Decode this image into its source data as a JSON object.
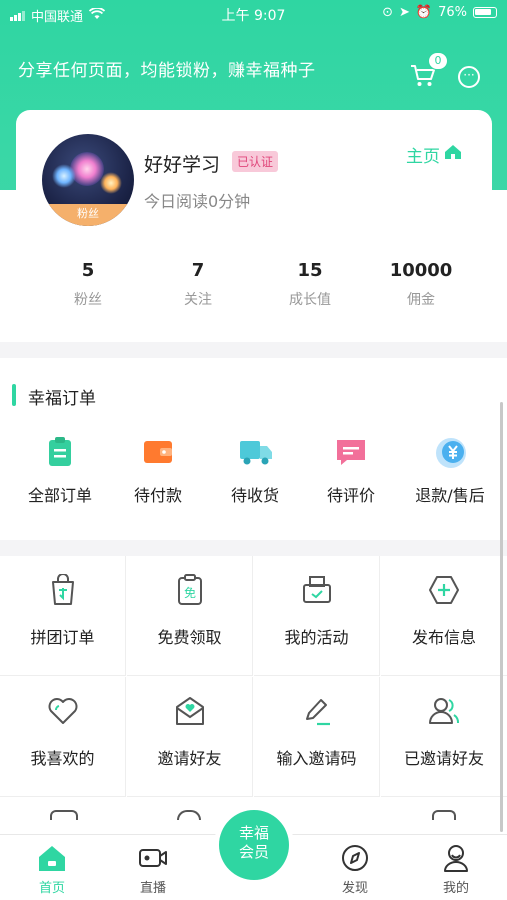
{
  "status_bar": {
    "carrier": "中国联通",
    "time": "上午 9:07",
    "battery": "76%"
  },
  "header": {
    "share_text": "分享任何页面，均能锁粉，赚幸福种子",
    "cart_count": "0"
  },
  "profile": {
    "avatar_label": "粉丝",
    "name": "好好学习",
    "verified_badge": "已认证",
    "home_link": "主页",
    "reading_today": "今日阅读0分钟"
  },
  "stats": [
    {
      "value": "5",
      "label": "粉丝"
    },
    {
      "value": "7",
      "label": "关注"
    },
    {
      "value": "15",
      "label": "成长值"
    },
    {
      "value": "10000",
      "label": "佣金"
    }
  ],
  "orders": {
    "title": "幸福订单",
    "items": [
      {
        "label": "全部订单",
        "icon": "clipboard-icon",
        "color": "#34cf9e"
      },
      {
        "label": "待付款",
        "icon": "wallet-icon",
        "color": "#ff7a2f"
      },
      {
        "label": "待收货",
        "icon": "truck-icon",
        "color": "#4dc9d9"
      },
      {
        "label": "待评价",
        "icon": "comment-icon",
        "color": "#f2709a"
      },
      {
        "label": "退款/售后",
        "icon": "yen-refund-icon",
        "color": "#4bb0ef"
      }
    ]
  },
  "grid": [
    {
      "label": "拼团订单",
      "icon": "group-buy-bag-icon"
    },
    {
      "label": "免费领取",
      "icon": "free-ticket-icon"
    },
    {
      "label": "我的活动",
      "icon": "activity-printer-icon"
    },
    {
      "label": "发布信息",
      "icon": "publish-plus-icon"
    },
    {
      "label": "我喜欢的",
      "icon": "heart-icon"
    },
    {
      "label": "邀请好友",
      "icon": "invite-envelope-icon"
    },
    {
      "label": "输入邀请码",
      "icon": "edit-pen-icon"
    },
    {
      "label": "已邀请好友",
      "icon": "invited-users-icon"
    }
  ],
  "tabbar": {
    "items": [
      {
        "label": "首页",
        "icon": "home-icon"
      },
      {
        "label": "直播",
        "icon": "video-camera-icon"
      },
      {
        "label": "发现",
        "icon": "compass-icon"
      },
      {
        "label": "我的",
        "icon": "profile-icon"
      }
    ],
    "vip_line1": "幸福",
    "vip_line2": "会员"
  },
  "accent_color": "#2fd6a2"
}
